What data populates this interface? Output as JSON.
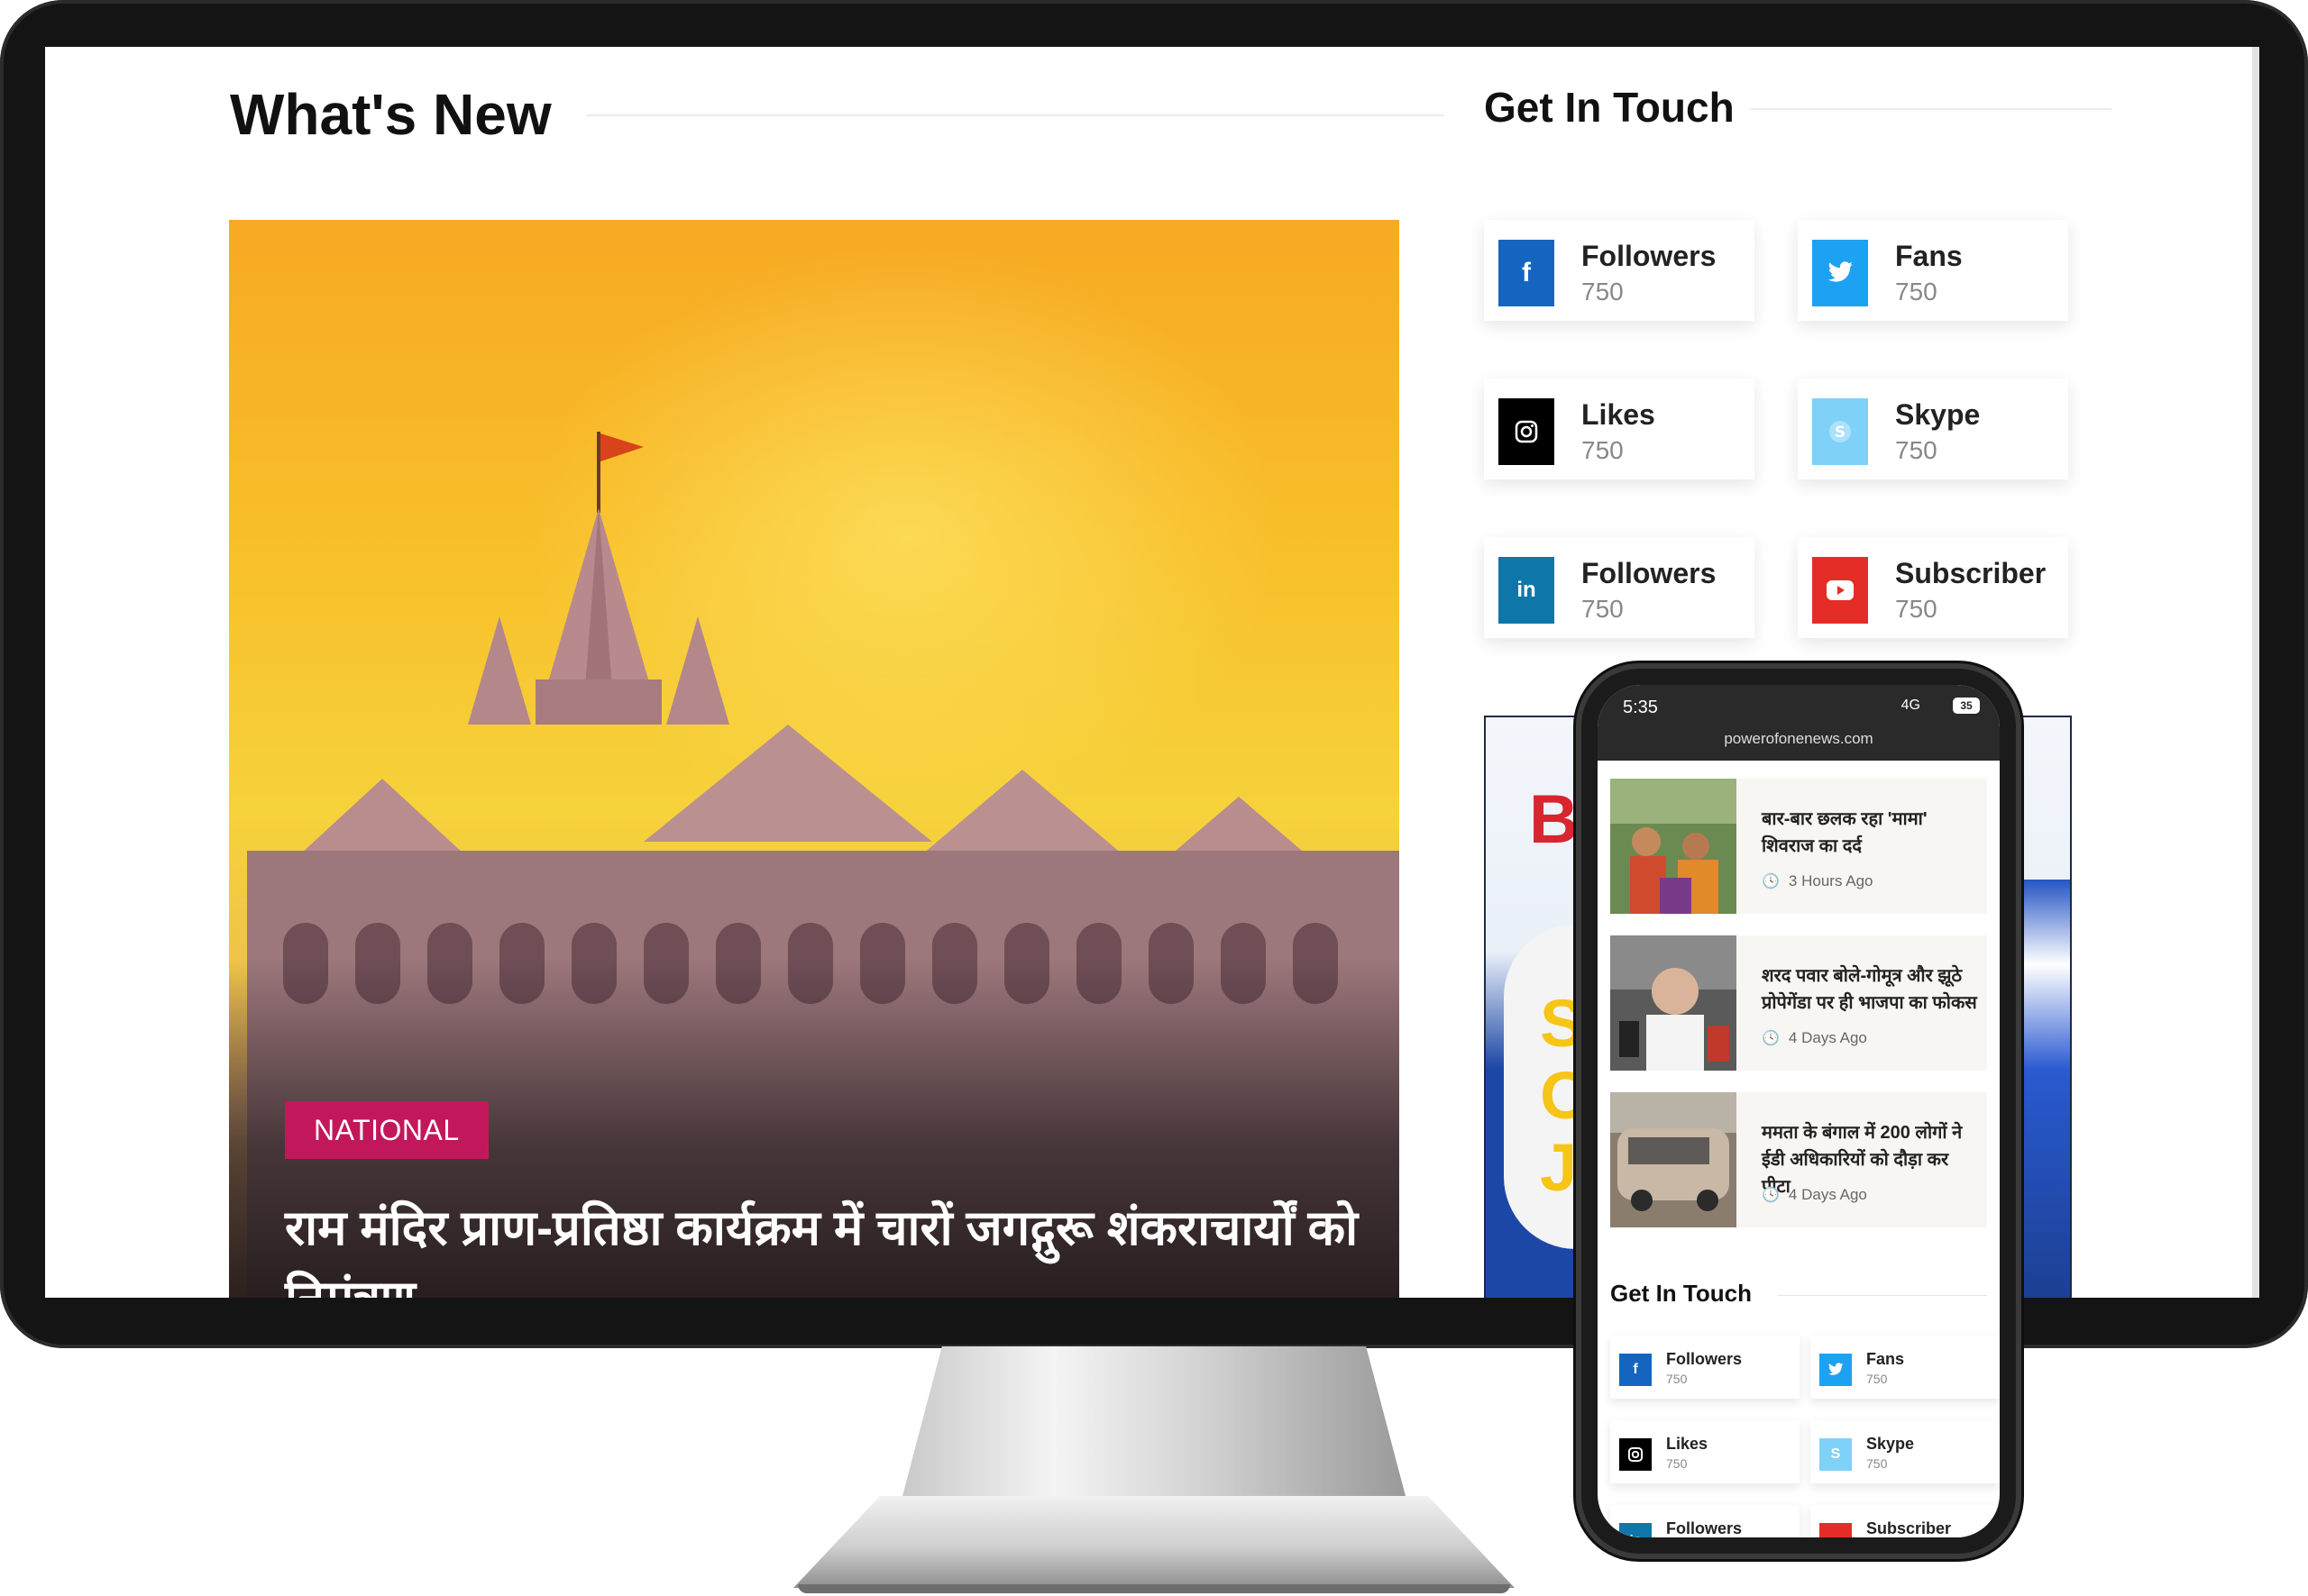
{
  "desktop": {
    "whats_new_title": "What's New",
    "get_in_touch_title": "Get In Touch",
    "hero": {
      "category": "NATIONAL",
      "headline": "राम मंदिर प्राण-प्रतिष्ठा कार्यक्रम में चारों जगद्गुरू शंकराचार्यों को निमंत्रण"
    },
    "social": [
      {
        "network": "facebook",
        "icon": "facebook-icon",
        "glyph": "f",
        "label": "Followers",
        "count": "750",
        "color": "#1565c0"
      },
      {
        "network": "twitter",
        "icon": "twitter-icon",
        "glyph": "🐦",
        "label": "Fans",
        "count": "750",
        "color": "#1da1f2"
      },
      {
        "network": "instagram",
        "icon": "instagram-icon",
        "glyph": "◎",
        "label": "Likes",
        "count": "750",
        "color": "#000000"
      },
      {
        "network": "skype",
        "icon": "skype-icon",
        "glyph": "S",
        "label": "Skype",
        "count": "750",
        "color": "#7fd1f7"
      },
      {
        "network": "linkedin",
        "icon": "linkedin-icon",
        "glyph": "in",
        "label": "Followers",
        "count": "750",
        "color": "#0e76a8"
      },
      {
        "network": "youtube",
        "icon": "youtube-icon",
        "glyph": "▶",
        "label": "Subscriber",
        "count": "750",
        "color": "#e52d27"
      }
    ],
    "ad": {
      "brand_text": "BA",
      "promo_text": "S\nO\nJi"
    }
  },
  "phone": {
    "time": "5:35",
    "signal": "4G",
    "battery": "35",
    "url": "powerofonenews.com",
    "news": [
      {
        "title": "बार-बार छलक रहा 'मामा' शिवराज का दर्द",
        "time": "3 Hours Ago"
      },
      {
        "title": "शरद पवार बोले-गोमूत्र और झूठे प्रोपेगेंडा पर ही भाजपा का फोकस",
        "time": "4 Days Ago"
      },
      {
        "title": "ममता के बंगाल में 200 लोगों ने ईडी अधिकारियों को दौड़ा कर पीटा",
        "time": "4 Days Ago"
      }
    ],
    "get_in_touch_title": "Get In Touch",
    "social": [
      {
        "icon": "facebook-icon",
        "glyph": "f",
        "label": "Followers",
        "count": "750",
        "color": "#1565c0"
      },
      {
        "icon": "twitter-icon",
        "glyph": "🐦",
        "label": "Fans",
        "count": "750",
        "color": "#1da1f2"
      },
      {
        "icon": "instagram-icon",
        "glyph": "◎",
        "label": "Likes",
        "count": "750",
        "color": "#000000"
      },
      {
        "icon": "skype-icon",
        "glyph": "S",
        "label": "Skype",
        "count": "750",
        "color": "#7fd1f7"
      },
      {
        "icon": "linkedin-icon",
        "glyph": "in",
        "label": "Followers",
        "count": "",
        "color": "#0e76a8"
      },
      {
        "icon": "youtube-icon",
        "glyph": "▶",
        "label": "Subscriber",
        "count": "",
        "color": "#e52d27"
      }
    ]
  }
}
